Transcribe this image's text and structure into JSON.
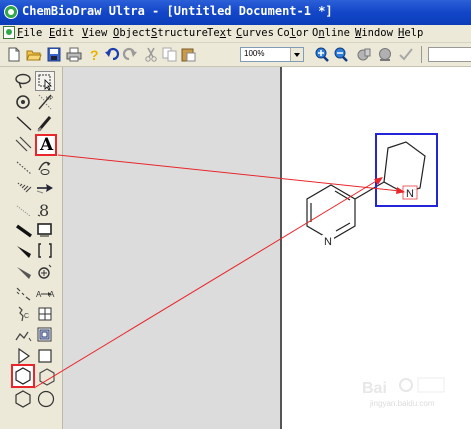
{
  "window": {
    "title": "ChemBioDraw Ultra - [Untitled Document-1 *]",
    "app_icon": "chembiodraw-logo-icon"
  },
  "menubar": {
    "items": [
      "File",
      "Edit",
      "View",
      "Object",
      "Structure",
      "Text",
      "Curves",
      "Color",
      "Online",
      "Window",
      "Help"
    ],
    "mnemonics": [
      "F",
      "E",
      "V",
      "O",
      "S",
      "x",
      "C",
      "l",
      "n",
      "W",
      "H"
    ]
  },
  "toolbar": {
    "icons": [
      "new-document-icon",
      "open-folder-icon",
      "save-icon",
      "print-icon",
      "help-icon",
      "undo-icon",
      "redo-icon",
      "cut-icon",
      "copy-icon",
      "paste-icon",
      "zoom-in-icon",
      "zoom-out-icon",
      "chemical-shift-icon",
      "analysis-icon",
      "check-structure-icon"
    ],
    "zoom_value": "100%"
  },
  "palette": {
    "tools": [
      "lasso-icon",
      "marquee-icon",
      "eraser-icon",
      "mass-fragment-icon",
      "solid-bond-icon",
      "chain-icon",
      "multiple-bond-icon",
      "text-tool-icon",
      "hashed-bond-icon",
      "orbital-icon",
      "hashed-wedge-bond-icon",
      "arrow-icon",
      "wavy-bond-icon",
      "chemical-symbol-icon",
      "bold-bond-icon",
      "rectangle-icon",
      "wedge-bond-icon",
      "brackets-icon",
      "hollow-wedge-bond-icon",
      "charge-icon",
      "dashed-bond-icon",
      "reaction-mapping-icon",
      "chain-icon-2",
      "table-icon",
      "acyclic-chain-icon",
      "template-icon",
      "play-icon",
      "square-icon",
      "cyclohexane-icon",
      "cyclopentane-icon",
      "benzene-icon",
      "cyclooctane-icon"
    ],
    "text_tool_label": "A"
  },
  "molecule": {
    "nitrogen_labels": [
      "N",
      "N"
    ]
  },
  "highlight_color": "#e8262b",
  "selection_color": "#2424d8",
  "watermark": {
    "url_text": "jingyan.baidu.com"
  }
}
